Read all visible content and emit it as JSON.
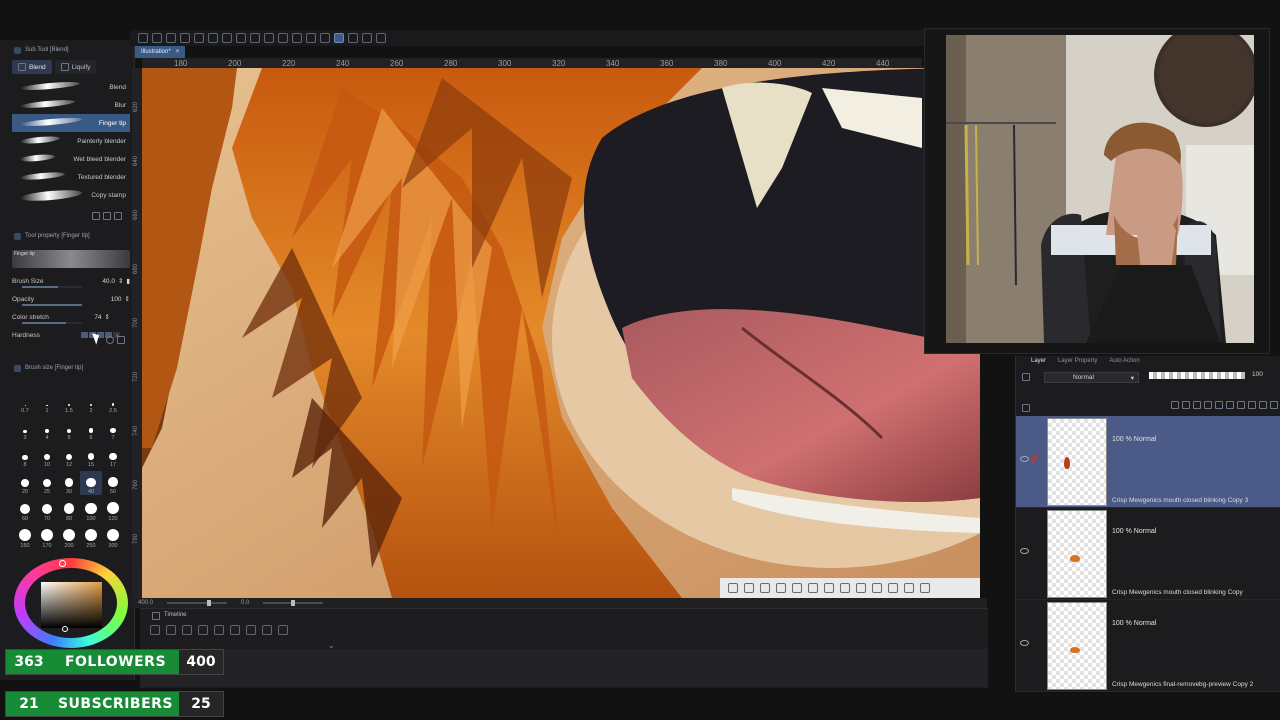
{
  "subtool": {
    "header": "Sub Tool [Blend]",
    "tabs": [
      {
        "label": "Blend",
        "active": true
      },
      {
        "label": "Liquify",
        "active": false
      }
    ],
    "brushes": [
      {
        "label": "Blend",
        "active": false
      },
      {
        "label": "Blur",
        "active": false
      },
      {
        "label": "Finger tip",
        "active": true
      },
      {
        "label": "Painterly blender",
        "active": false
      },
      {
        "label": "Wet bleed blender",
        "active": false
      },
      {
        "label": "Textured blender",
        "active": false
      },
      {
        "label": "Copy stamp",
        "active": false
      }
    ]
  },
  "tool_property": {
    "header": "Tool property [Finger tip]",
    "preview_label": "Finger tip",
    "brush_size_label": "Brush Size",
    "brush_size_value": "40.0",
    "opacity_label": "Opacity",
    "opacity_value": "100",
    "color_stretch_label": "Color stretch",
    "color_stretch_value": "74",
    "hardness_label": "Hardness",
    "hardness_level": 4,
    "hardness_steps": 5
  },
  "brush_size_palette": {
    "header": "Brush size [Finger tip]",
    "sizes": [
      "0.7",
      "1",
      "1.5",
      "2",
      "2.5",
      "3",
      "4",
      "5",
      "6",
      "7",
      "8",
      "10",
      "12",
      "15",
      "17",
      "20",
      "25",
      "30",
      "40",
      "50",
      "60",
      "70",
      "80",
      "100",
      "120",
      "150",
      "170",
      "200",
      "250",
      "300"
    ],
    "selected": "40"
  },
  "color": {
    "hue": "#e39b43"
  },
  "document": {
    "tab_label": "Illustration*"
  },
  "ruler_top": [
    "180",
    "200",
    "220",
    "240",
    "260",
    "280",
    "300",
    "320",
    "340",
    "360",
    "380",
    "400",
    "420",
    "440"
  ],
  "ruler_left": [
    "620",
    "640",
    "660",
    "680",
    "700",
    "720",
    "740",
    "760",
    "780"
  ],
  "status": {
    "zoom": "400.0",
    "angle": "0.0"
  },
  "timeline": {
    "title": "Timeline"
  },
  "layers": {
    "tabs": [
      {
        "label": "Layer",
        "active": true
      },
      {
        "label": "Layer Property",
        "active": false
      },
      {
        "label": "Auto Action",
        "active": false
      }
    ],
    "blend_mode": "Normal",
    "opacity": "100",
    "items": [
      {
        "blend": "100 % Normal",
        "name": "Crisp Mewgenics mouth closed blinking Copy 3",
        "selected": true,
        "mark_color": "#b5401c"
      },
      {
        "blend": "100 % Normal",
        "name": "Crisp Mewgenics mouth closed blinking Copy",
        "selected": false,
        "mark_color": "#d9731f"
      },
      {
        "blend": "100 % Normal",
        "name": "Crisp Mewgenics final-removebg-preview Copy 2",
        "selected": false,
        "mark_color": "#d9731f"
      }
    ]
  },
  "overlay": {
    "followers": {
      "current": "363",
      "label": "FOLLOWERS",
      "goal": "400"
    },
    "subscribers": {
      "current": "21",
      "label": "SUBSCRIBERS",
      "goal": "25"
    }
  }
}
